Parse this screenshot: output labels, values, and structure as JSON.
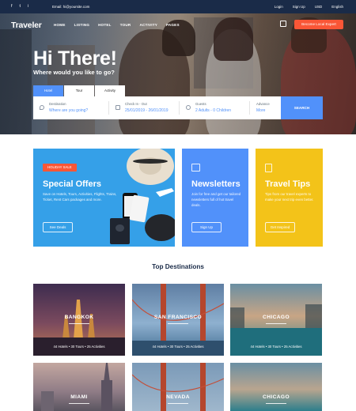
{
  "topbar": {
    "social": [
      "f",
      "t",
      "i"
    ],
    "email": "Email: hi@yoursite.com",
    "links": [
      "Login",
      "Sign Up",
      "USD",
      "English"
    ]
  },
  "nav": {
    "logo": "Traveler",
    "menu": [
      "HOME",
      "LISTING",
      "HOTEL",
      "TOUR",
      "ACTIVITY",
      "PAGES"
    ],
    "cta": "Become Local Expert"
  },
  "hero": {
    "title": "Hi There!",
    "subtitle": "Where would you like to go?",
    "tabs": [
      "Hotel",
      "Tour",
      "Activity"
    ],
    "active_tab": "Hotel"
  },
  "search": {
    "destination": {
      "label": "Destination",
      "value": "Where are you going?"
    },
    "dates": {
      "label": "Check In - Out",
      "value": "25/01/2019 - 26/01/2019"
    },
    "guests": {
      "label": "Guests",
      "value": "2 Adults - 0 Children"
    },
    "advance": {
      "label": "Advance",
      "value": "More"
    },
    "button": "SEARCH"
  },
  "promos": {
    "special": {
      "badge": "HOLIDAY SALE",
      "title": "Special Offers",
      "desc": "Save on Hotels, Tours, Activities, Flights, Trains, Ticket, Rent Cars packages and more.",
      "button": "See Deals"
    },
    "newsletter": {
      "title": "Newsletters",
      "desc": "Join for free and get our tailored newsletters full of hot travel deals.",
      "button": "Sign Up"
    },
    "tips": {
      "title": "Travel Tips",
      "desc": "Tips from our travel experts to make your next trip even better.",
      "button": "Get Inspired"
    }
  },
  "destinations": {
    "title": "Top Destinations",
    "items": [
      {
        "name": "BANGKOK",
        "stats": "44 Hotels • 30 Tours • 25 Activities"
      },
      {
        "name": "SAN FRANCISCO",
        "stats": "44 Hotels • 30 Tours • 25 Activities"
      },
      {
        "name": "CHICAGO",
        "stats": "44 Hotels • 30 Tours • 25 Activities"
      },
      {
        "name": "MIAMI",
        "stats": ""
      },
      {
        "name": "NEVADA",
        "stats": ""
      },
      {
        "name": "CHICAGO",
        "stats": ""
      }
    ]
  },
  "colors": {
    "navy": "#1a2b48",
    "primary": "#5191fa",
    "accent": "#fa5636",
    "special_card": "#35a0e8",
    "tips_card": "#f3c319"
  }
}
